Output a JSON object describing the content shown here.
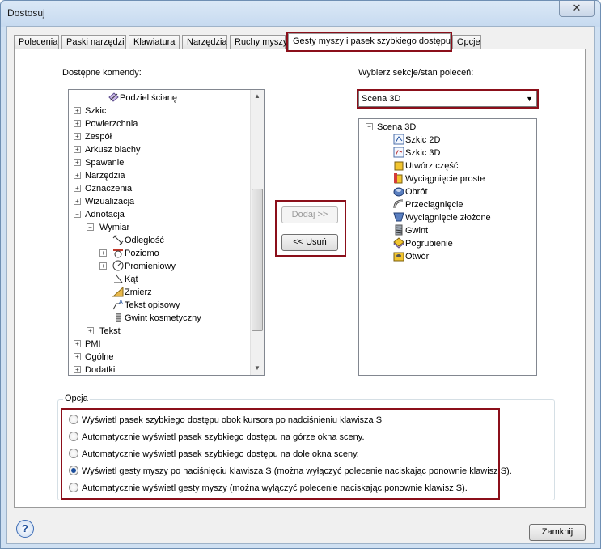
{
  "window": {
    "title": "Dostosuj",
    "close_glyph": "✕"
  },
  "tabs": [
    {
      "label": "Polecenia",
      "active": false
    },
    {
      "label": "Paski narzędzi",
      "active": false
    },
    {
      "label": "Klawiatura",
      "active": false
    },
    {
      "label": "Narzędzia",
      "active": false
    },
    {
      "label": "Ruchy myszy",
      "active": false
    },
    {
      "label": "Gesty myszy i pasek szybkiego dostępu",
      "active": true
    },
    {
      "label": "Opcje",
      "active": false
    }
  ],
  "left": {
    "label": "Dostępne komendy:",
    "tree": [
      {
        "text": "Podziel ścianę",
        "icon": "split-face-icon"
      },
      {
        "text": "Szkic",
        "expand": "+"
      },
      {
        "text": "Powierzchnia",
        "expand": "+"
      },
      {
        "text": "Zespół",
        "expand": "+"
      },
      {
        "text": "Arkusz blachy",
        "expand": "+"
      },
      {
        "text": "Spawanie",
        "expand": "+"
      },
      {
        "text": "Narzędzia",
        "expand": "+"
      },
      {
        "text": "Oznaczenia",
        "expand": "+"
      },
      {
        "text": "Wizualizacja",
        "expand": "+"
      },
      {
        "text": "Adnotacja",
        "expand": "−"
      },
      {
        "text": "Wymiar",
        "expand": "−"
      },
      {
        "text": "Odległość",
        "icon": "distance-dimension-icon"
      },
      {
        "text": "Poziomo",
        "expand": "+",
        "icon": "horizontal-dimension-icon"
      },
      {
        "text": "Promieniowy",
        "expand": "+",
        "icon": "radial-dimension-icon"
      },
      {
        "text": "Kąt",
        "icon": "angle-dimension-icon"
      },
      {
        "text": "Zmierz",
        "icon": "measure-icon"
      },
      {
        "text": "Tekst opisowy",
        "icon": "leader-text-icon"
      },
      {
        "text": "Gwint kosmetyczny",
        "icon": "cosmetic-thread-icon"
      },
      {
        "text": "Tekst",
        "expand": "+"
      },
      {
        "text": "PMI",
        "expand": "+"
      },
      {
        "text": "Ogólne",
        "expand": "+"
      },
      {
        "text": "Dodatki",
        "expand": "+"
      }
    ]
  },
  "middle": {
    "add_label": "Dodaj >>",
    "remove_label": "<< Usuń"
  },
  "right": {
    "label": "Wybierz sekcje/stan poleceń:",
    "combo_value": "Scena 3D",
    "tree_root": "Scena 3D",
    "tree": [
      {
        "text": "Szkic 2D",
        "icon": "sketch-2d-icon"
      },
      {
        "text": "Szkic 3D",
        "icon": "sketch-3d-icon"
      },
      {
        "text": "Utwórz część",
        "icon": "create-part-icon"
      },
      {
        "text": "Wyciągnięcie proste",
        "icon": "extrude-icon"
      },
      {
        "text": "Obrót",
        "icon": "revolve-icon"
      },
      {
        "text": "Przeciągnięcie",
        "icon": "sweep-icon"
      },
      {
        "text": "Wyciągnięcie złożone",
        "icon": "loft-icon"
      },
      {
        "text": "Gwint",
        "icon": "thread-icon"
      },
      {
        "text": "Pogrubienie",
        "icon": "thicken-icon"
      },
      {
        "text": "Otwór",
        "icon": "hole-icon"
      }
    ]
  },
  "options": {
    "title": "Opcja",
    "items": [
      {
        "label": "Wyświetl pasek szybkiego dostępu obok kursora po nadciśnieniu klawisza S",
        "checked": false
      },
      {
        "label": "Automatycznie wyświetl pasek szybkiego dostępu na górze okna sceny.",
        "checked": false
      },
      {
        "label": "Automatycznie wyświetl pasek szybkiego dostępu na dole okna sceny.",
        "checked": false
      },
      {
        "label": "Wyświetl gesty myszy po naciśnięciu klawisza S (można wyłączyć polecenie naciskając ponownie klawisz S).",
        "checked": true
      },
      {
        "label": "Automatycznie wyświetl gesty myszy (można wyłączyć polecenie naciskając ponownie klawisz S).",
        "checked": false
      }
    ]
  },
  "footer": {
    "help_glyph": "?",
    "close_label": "Zamknij"
  },
  "colors": {
    "highlight": "#8b0f1a",
    "frame": "#cfe0f2",
    "radio_dot": "#1c4e9c"
  }
}
